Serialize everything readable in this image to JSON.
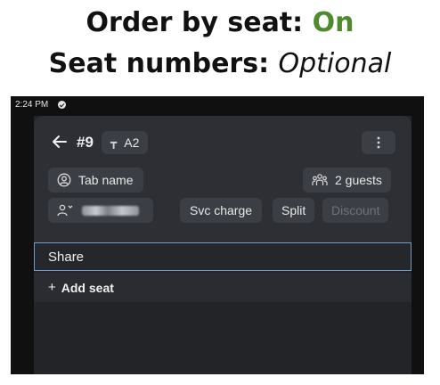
{
  "headline": {
    "line1_prefix": "Order by seat: ",
    "line1_value": "On",
    "line2_prefix": "Seat numbers: ",
    "line2_value": "Optional",
    "value_color_on": "#4f8a2f"
  },
  "status_bar": {
    "time": "2:24 PM",
    "status_icon": "check-circle-icon"
  },
  "order": {
    "back_icon": "back-arrow-icon",
    "order_number": "#9",
    "table_icon": "table-icon",
    "table_label": "A2",
    "more_icon": "more-vertical-icon",
    "tab_icon": "person-circle-icon",
    "tab_name_label": "Tab name",
    "guests_icon": "group-icon",
    "guests_label": "2 guests",
    "customer_icon": "add-customer-icon",
    "customer_name": "(redacted)",
    "svc_charge_label": "Svc charge",
    "split_label": "Split",
    "discount_label": "Discount"
  },
  "seats": {
    "share_label": "Share",
    "add_seat_icon": "plus-icon",
    "add_seat_label": "Add seat"
  },
  "colors": {
    "panel": "#2d2f34",
    "pill": "#3b3e44",
    "selected_border": "#6f9bd1",
    "disabled_text": "#6f7278"
  }
}
